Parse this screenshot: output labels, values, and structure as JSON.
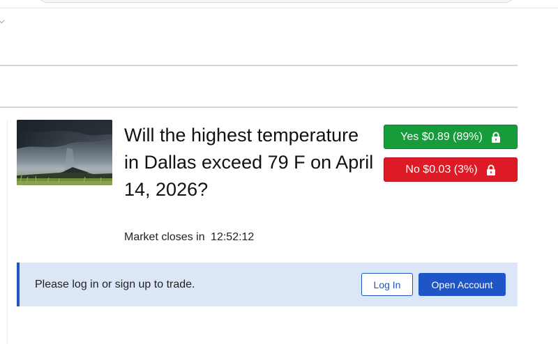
{
  "market": {
    "title": "Will the highest temperature in Dallas exceed 79 F on April 14, 2026?",
    "closes_label": "Market closes in",
    "countdown": "12:52:12",
    "image_icon": "storm-landscape-image"
  },
  "options": {
    "yes_label": "Yes $0.89 (89%)",
    "no_label": "No $0.03 (3%)",
    "lock_icon": "lock-icon",
    "colors": {
      "yes": "#179c3c",
      "no": "#dd1a25"
    }
  },
  "login_prompt": {
    "message": "Please log in or sign up to trade.",
    "login_label": "Log In",
    "open_account_label": "Open Account",
    "accent": "#1f55c4"
  }
}
